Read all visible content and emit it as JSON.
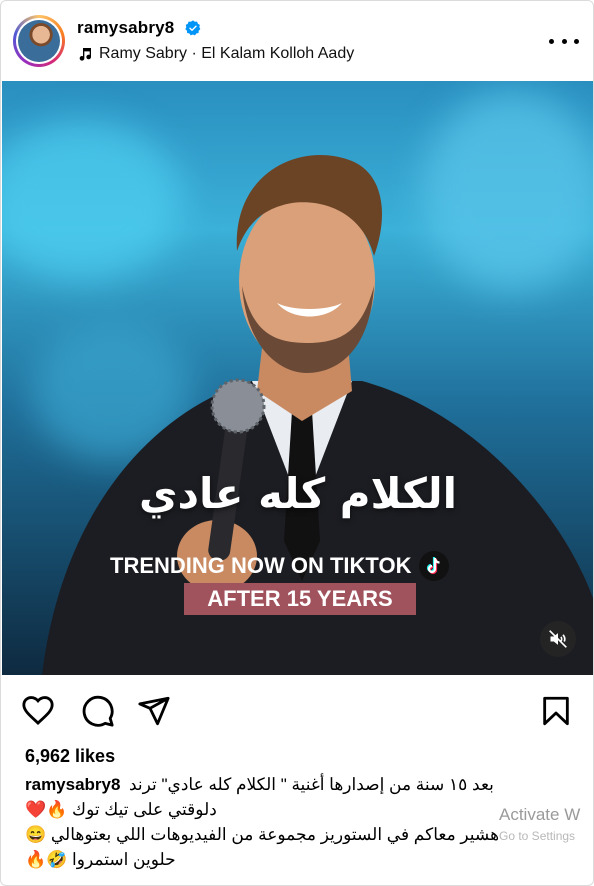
{
  "header": {
    "username": "ramysabry8",
    "audio": "Ramy Sabry · El Kalam Kolloh Aady"
  },
  "media": {
    "title_ar": "الكلام كله عادي",
    "trending": "TRENDING NOW ON TIKTOK",
    "badge": "AFTER 15 YEARS"
  },
  "likes": "6,962 likes",
  "caption": {
    "username": "ramysabry8",
    "line1": "بعد ١٥ سنة من إصدارها أغنية \" الكلام كله عادي\" ترند",
    "line2": "دلوقتي على تيك توك 🔥❤️",
    "line3": "هشير معاكم في الستوريز مجموعة من الفيديوهات اللي بعتوهالي 😄",
    "line4": "حلوين استمروا 🤣🔥"
  },
  "overlay": {
    "activate": "Activate W",
    "settings": "Go to Settings"
  },
  "colors": {
    "verified": "#0095f6",
    "badge": "#a0535c"
  }
}
